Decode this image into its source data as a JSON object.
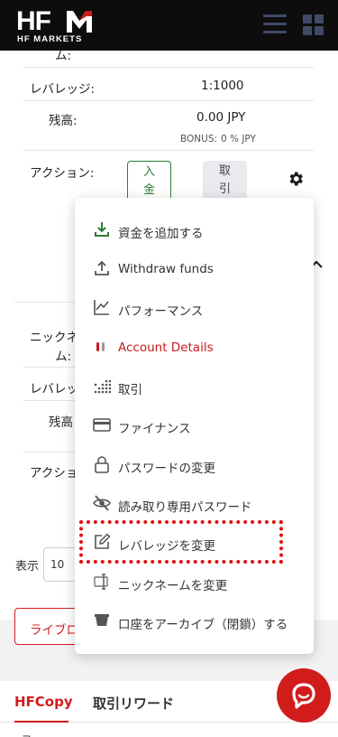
{
  "header": {
    "logo_main": "HF",
    "logo_sub": "HF MARKETS"
  },
  "account1": {
    "nickname_tail": "ム:",
    "leverage_label": "レバレッジ:",
    "leverage_value": "1:1000",
    "balance_label": "残高:",
    "balance_value": "0.00 JPY",
    "bonus_label": "BONUS:",
    "bonus_value": "0 % JPY",
    "action_label": "アクション:",
    "deposit_label_1": "入",
    "deposit_label_2": "金",
    "trade_label_1": "取",
    "trade_label_2": "引"
  },
  "account2": {
    "nickname_label_1": "ニックネ",
    "nickname_label_2": "ム:",
    "leverage_label": "レバレッ",
    "balance_label": "残高",
    "action_label": "アクショ"
  },
  "pagination": {
    "show_label": "表示",
    "page_size": "10"
  },
  "library_button": "ライブロ",
  "tabs": [
    {
      "label": "HFCopy",
      "active": true
    },
    {
      "label": "取引リワード",
      "active": false
    }
  ],
  "tab_bottom_text": "フ",
  "menu": {
    "items": [
      {
        "label": "資金を追加する",
        "icon": "download-icon"
      },
      {
        "label": "Withdraw funds",
        "icon": "upload-icon"
      },
      {
        "label": "パフォーマンス",
        "icon": "chart-icon"
      },
      {
        "label": "Account Details",
        "icon": "pause-icon"
      },
      {
        "label": "取引",
        "icon": "dots-icon"
      },
      {
        "label": "ファイナンス",
        "icon": "credit-card-icon"
      },
      {
        "label": "パスワードの変更",
        "icon": "lock-icon"
      },
      {
        "label": "読み取り専用パスワード",
        "icon": "eye-off-icon"
      },
      {
        "label": "レバレッジを変更",
        "icon": "edit-icon"
      },
      {
        "label": "ニックネームを変更",
        "icon": "rename-icon"
      },
      {
        "label": "口座をアーカイブ（閉鎖）する",
        "icon": "archive-icon"
      }
    ]
  },
  "colors": {
    "brand_red": "#d21c1c",
    "deposit_green": "#2e7d32",
    "header_bg": "#0d0d0d"
  }
}
